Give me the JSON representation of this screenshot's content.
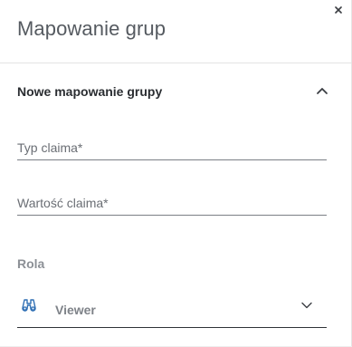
{
  "dialog": {
    "title": "Mapowanie grup",
    "close_icon": "close-icon"
  },
  "panel": {
    "title": "Nowe mapowanie grupy",
    "collapse_icon": "chevron-up-icon"
  },
  "form": {
    "claim_type": {
      "label": "Typ claima*",
      "value": ""
    },
    "claim_value": {
      "label": "Wartość claima*",
      "value": ""
    },
    "role": {
      "label": "Rola",
      "selected": "Viewer",
      "icon": "binoculars-icon",
      "dropdown_icon": "chevron-down-icon"
    }
  },
  "colors": {
    "title": "#555a60",
    "label": "#6a6e74",
    "icon_accent": "#2f6fb4"
  }
}
